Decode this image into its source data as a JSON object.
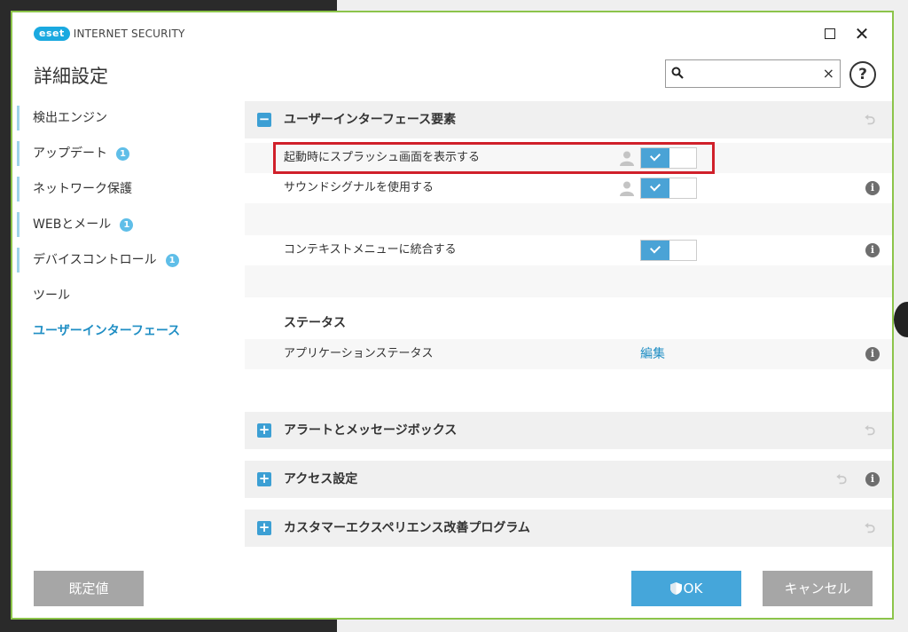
{
  "window": {
    "logo_brand": "eset",
    "logo_product": "INTERNET SECURITY",
    "page_title": "詳細設定",
    "accent_color": "#1aa9e0",
    "border_color": "#8cc44a"
  },
  "search": {
    "value": "",
    "placeholder": ""
  },
  "sidebar": {
    "items": [
      {
        "label": "検出エンジン",
        "badge": ""
      },
      {
        "label": "アップデート",
        "badge": "1"
      },
      {
        "label": "ネットワーク保護",
        "badge": ""
      },
      {
        "label": "WEBとメール",
        "badge": "1"
      },
      {
        "label": "デバイスコントロール",
        "badge": "1"
      },
      {
        "label": "ツール",
        "badge": ""
      },
      {
        "label": "ユーザーインターフェース",
        "badge": "",
        "active": true
      }
    ]
  },
  "sections": {
    "ui_elements": {
      "title": "ユーザーインターフェース要素",
      "toggle": "−",
      "rows": {
        "splash": {
          "label": "起動時にスプラッシュ画面を表示する",
          "enabled": true
        },
        "sound": {
          "label": "サウンドシグナルを使用する",
          "enabled": true
        },
        "context_menu": {
          "label": "コンテキストメニューに統合する",
          "enabled": true
        }
      },
      "status": {
        "heading": "ステータス",
        "app_status_label": "アプリケーションステータス",
        "edit_link": "編集"
      }
    },
    "alerts": {
      "title": "アラートとメッセージボックス",
      "toggle": "+"
    },
    "access": {
      "title": "アクセス設定",
      "toggle": "+"
    },
    "cx_program": {
      "title": "カスタマーエクスペリエンス改善プログラム",
      "toggle": "+"
    }
  },
  "footer": {
    "default_label": "既定値",
    "ok_label": "OK",
    "cancel_label": "キャンセル"
  },
  "icons": {
    "info": "i",
    "revert": "⮌",
    "close": "✕",
    "clear": "×",
    "help": "?"
  }
}
